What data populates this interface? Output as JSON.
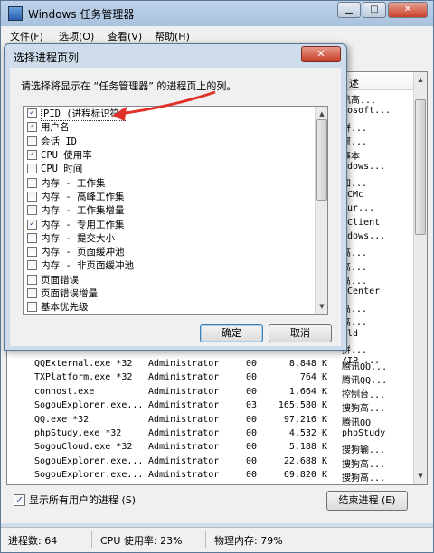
{
  "window": {
    "title": "Windows 任务管理器",
    "controls": {
      "minimize": "▁",
      "maximize": "□",
      "close": "✕"
    }
  },
  "menu": [
    "文件(F)",
    "选项(O)",
    "查看(V)",
    "帮助(H)"
  ],
  "process_panel": {
    "desc_header": "述",
    "desc_column_visible": [
      "讯高...",
      "rosoft...",
      "拼...",
      "窗...",
      "事本",
      "ndows...",
      "加...",
      "NCMc",
      "Sur...",
      "tClient",
      "ndows...",
      "高...",
      "高...",
      "高...",
      "eCenter",
      "高...",
      "高...",
      "ald",
      "拼...",
      "/IP ..."
    ],
    "rows": [
      {
        "name": "QQExternal.exe *32",
        "user": "Administrator",
        "cpu": "00",
        "mem": "8,848 K",
        "desc": "腾讯QQ..."
      },
      {
        "name": "TXPlatform.exe *32",
        "user": "Administrator",
        "cpu": "00",
        "mem": "764 K",
        "desc": "腾讯QQ..."
      },
      {
        "name": "conhost.exe",
        "user": "Administrator",
        "cpu": "00",
        "mem": "1,664 K",
        "desc": "控制台..."
      },
      {
        "name": "SogouExplorer.exe...",
        "user": "Administrator",
        "cpu": "03",
        "mem": "165,580 K",
        "desc": "搜狗高..."
      },
      {
        "name": "QQ.exe *32",
        "user": "Administrator",
        "cpu": "00",
        "mem": "97,216 K",
        "desc": "腾讯QQ"
      },
      {
        "name": "phpStudy.exe *32",
        "user": "Administrator",
        "cpu": "00",
        "mem": "4,532 K",
        "desc": "phpStudy"
      },
      {
        "name": "SogouCloud.exe *32",
        "user": "Administrator",
        "cpu": "00",
        "mem": "5,188 K",
        "desc": "搜狗输..."
      },
      {
        "name": "SogouExplorer.exe...",
        "user": "Administrator",
        "cpu": "00",
        "mem": "22,688 K",
        "desc": "搜狗高..."
      },
      {
        "name": "SogouExplorer.exe...",
        "user": "Administrator",
        "cpu": "00",
        "mem": "69,820 K",
        "desc": "搜狗高..."
      }
    ],
    "show_all_label": "显示所有用户的进程 (S)",
    "show_all_checked": true,
    "end_process_label": "结束进程 (E)"
  },
  "status": {
    "processes": "进程数: 64",
    "cpu": "CPU 使用率: 23%",
    "memory": "物理内存: 79%"
  },
  "dialog": {
    "title": "选择进程页列",
    "close": "✕",
    "prompt": "请选择将显示在 “任务管理器” 的进程页上的列。",
    "columns": [
      {
        "label": "PID (进程标识符)",
        "checked": true
      },
      {
        "label": "用户名",
        "checked": true
      },
      {
        "label": "会话 ID",
        "checked": false
      },
      {
        "label": "CPU 使用率",
        "checked": true
      },
      {
        "label": "CPU 时间",
        "checked": false
      },
      {
        "label": "内存 - 工作集",
        "checked": false
      },
      {
        "label": "内存 - 高峰工作集",
        "checked": false
      },
      {
        "label": "内存 - 工作集增量",
        "checked": false
      },
      {
        "label": "内存 - 专用工作集",
        "checked": true
      },
      {
        "label": "内存 - 提交大小",
        "checked": false
      },
      {
        "label": "内存 - 页面缓冲池",
        "checked": false
      },
      {
        "label": "内存 - 非页面缓冲池",
        "checked": false
      },
      {
        "label": "页面错误",
        "checked": false
      },
      {
        "label": "页面错误增量",
        "checked": false
      },
      {
        "label": "基本优先级",
        "checked": false
      }
    ],
    "ok_label": "确定",
    "cancel_label": "取消"
  },
  "colors": {
    "annotation_arrow": "#e0302a",
    "title_bar": "#bfd3ea"
  }
}
